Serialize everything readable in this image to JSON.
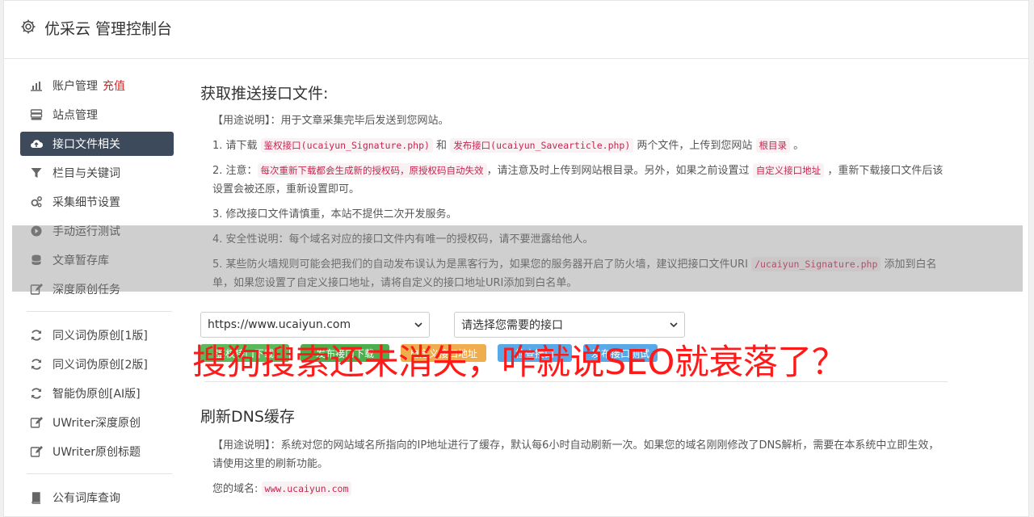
{
  "header": {
    "title": "优采云 管理控制台"
  },
  "sidebar": {
    "group1": [
      {
        "label": "账户管理",
        "badge": "充值",
        "icon": "bar-chart-icon"
      },
      {
        "label": "站点管理",
        "icon": "server-icon"
      },
      {
        "label": "接口文件相关",
        "icon": "cloud-upload-icon",
        "active": true
      },
      {
        "label": "栏目与关键词",
        "icon": "filter-icon"
      },
      {
        "label": "采集细节设置",
        "icon": "gears-icon"
      },
      {
        "label": "手动运行测试",
        "icon": "play-circle-icon"
      },
      {
        "label": "文章暂存库",
        "icon": "database-icon"
      },
      {
        "label": "深度原创任务",
        "icon": "edit-icon"
      }
    ],
    "group2": [
      {
        "label": "同义词伪原创[1版]",
        "icon": "refresh-icon"
      },
      {
        "label": "同义词伪原创[2版]",
        "icon": "refresh-icon"
      },
      {
        "label": "智能伪原创[AI版]",
        "icon": "refresh-icon"
      },
      {
        "label": "UWriter深度原创",
        "icon": "edit-icon"
      },
      {
        "label": "UWriter原创标题",
        "icon": "edit-icon"
      }
    ],
    "group3": [
      {
        "label": "公有词库查询",
        "icon": "book-icon"
      }
    ]
  },
  "main": {
    "section1": {
      "title": "获取推送接口文件:",
      "usage": "【用途说明】：用于文章采集完毕后发送到您网站。",
      "step1": {
        "a": "1. 请下载 ",
        "code1": "鉴权接口(ucaiyun_Signature.php)",
        "b": " 和 ",
        "code2": "发布接口(ucaiyun_Savearticle.php)",
        "c": " 两个文件，上传到您网站 ",
        "code3": "根目录",
        "d": " 。"
      },
      "step2": {
        "a": "2. 注意：",
        "code1": "每次重新下载都会生成新的授权码，原授权码自动失效",
        "b": "，请注意及时上传到网站根目录。另外，如果之前设置过 ",
        "code2": "自定义接口地址",
        "c": " ，重新下载接口文件后该设置会被还原，重新设置即可。"
      },
      "step3": "3. 修改接口文件请慎重，本站不提供二次开发服务。",
      "step4": "4. 安全性说明：每个域名对应的接口文件内有唯一的授权码，请不要泄露给他人。",
      "step5": {
        "a": "5. 某些防火墙规则可能会把我们的自动发布误认为是黑客行为，如果您的服务器开启了防火墙，建议把接口文件URI ",
        "code1": "/ucaiyun_Signature.php",
        "b": " 添加到白名单，如果您设置了自定义接口地址，请将自定义的接口地址URI添加到白名单。"
      },
      "select_site": "https://www.ucaiyun.com",
      "select_api": "请选择您需要的接口",
      "buttons": [
        "鉴权接口下载",
        "发布接口下载",
        "自定义接口地址",
        "检查接口",
        "发布接口测试"
      ]
    },
    "section2": {
      "title": "刷新DNS缓存",
      "usage": "【用途说明】：系统对您的网站域名所指向的IP地址进行了缓存，默认每6小时自动刷新一次。如果您的域名刚刚修改了DNS解析，需要在本系统中立即生效，请使用这里的刷新功能。",
      "domain_label": "您的域名:",
      "domain_value": "www.ucaiyun.com"
    }
  },
  "overlay": {
    "headline": "搜狗搜索还未消失，咋就说SEO就衰落了？"
  },
  "colors": {
    "active_nav": "#3d4a5c",
    "badge": "#e02020",
    "headline": "#ff1a1a",
    "code": "#c7254e"
  }
}
